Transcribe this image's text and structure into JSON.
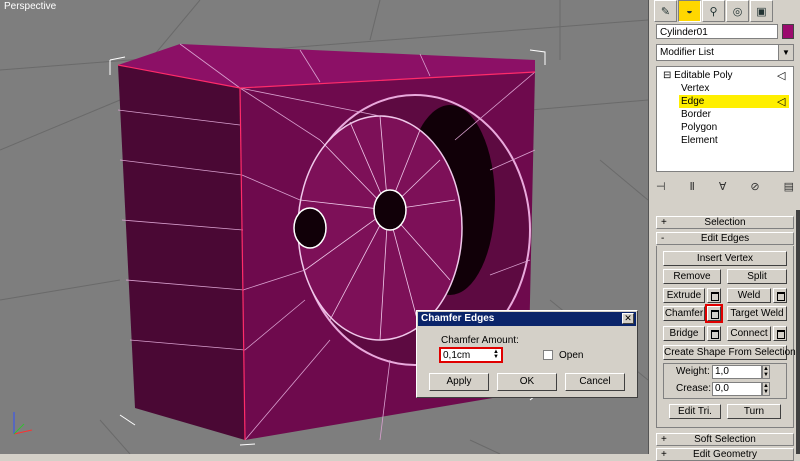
{
  "viewport": {
    "label": "Perspective"
  },
  "tabs": [
    {
      "icon": "create-icon"
    },
    {
      "icon": "modify-icon"
    },
    {
      "icon": "hierarchy-icon"
    },
    {
      "icon": "motion-icon"
    },
    {
      "icon": "display-icon"
    },
    {
      "icon": "utilities-icon"
    }
  ],
  "object": {
    "name": "Cylinder01",
    "color": "#9b0b6e"
  },
  "modifier_list": {
    "label": "Modifier List"
  },
  "stack": {
    "root": "Editable Poly",
    "sub": [
      "Vertex",
      "Edge",
      "Border",
      "Polygon",
      "Element"
    ],
    "selected": "Edge"
  },
  "rollouts": {
    "selection": "Selection",
    "edit_edges": "Edit Edges",
    "soft_selection": "Soft Selection",
    "edit_geometry": "Edit Geometry"
  },
  "buttons": {
    "insert_vertex": "Insert Vertex",
    "remove": "Remove",
    "split": "Split",
    "extrude": "Extrude",
    "weld": "Weld",
    "chamfer": "Chamfer",
    "target_weld": "Target Weld",
    "bridge": "Bridge",
    "connect": "Connect",
    "create_shape": "Create Shape From Selection",
    "edit_tri": "Edit Tri.",
    "turn": "Turn"
  },
  "fields": {
    "weight_label": "Weight:",
    "weight_value": "1,0",
    "crease_label": "Crease:",
    "crease_value": "0,0"
  },
  "dialog": {
    "title": "Chamfer Edges",
    "amount_label": "Chamfer Amount:",
    "amount_value": "0,1cm",
    "open_label": "Open",
    "apply": "Apply",
    "ok": "OK",
    "cancel": "Cancel"
  },
  "colors": {
    "mesh": "#6e0a4d",
    "mesh_light": "#8c1066",
    "selected_item": "#ffef00",
    "dialog_title": "#0a246a",
    "highlight": "#e00000"
  }
}
